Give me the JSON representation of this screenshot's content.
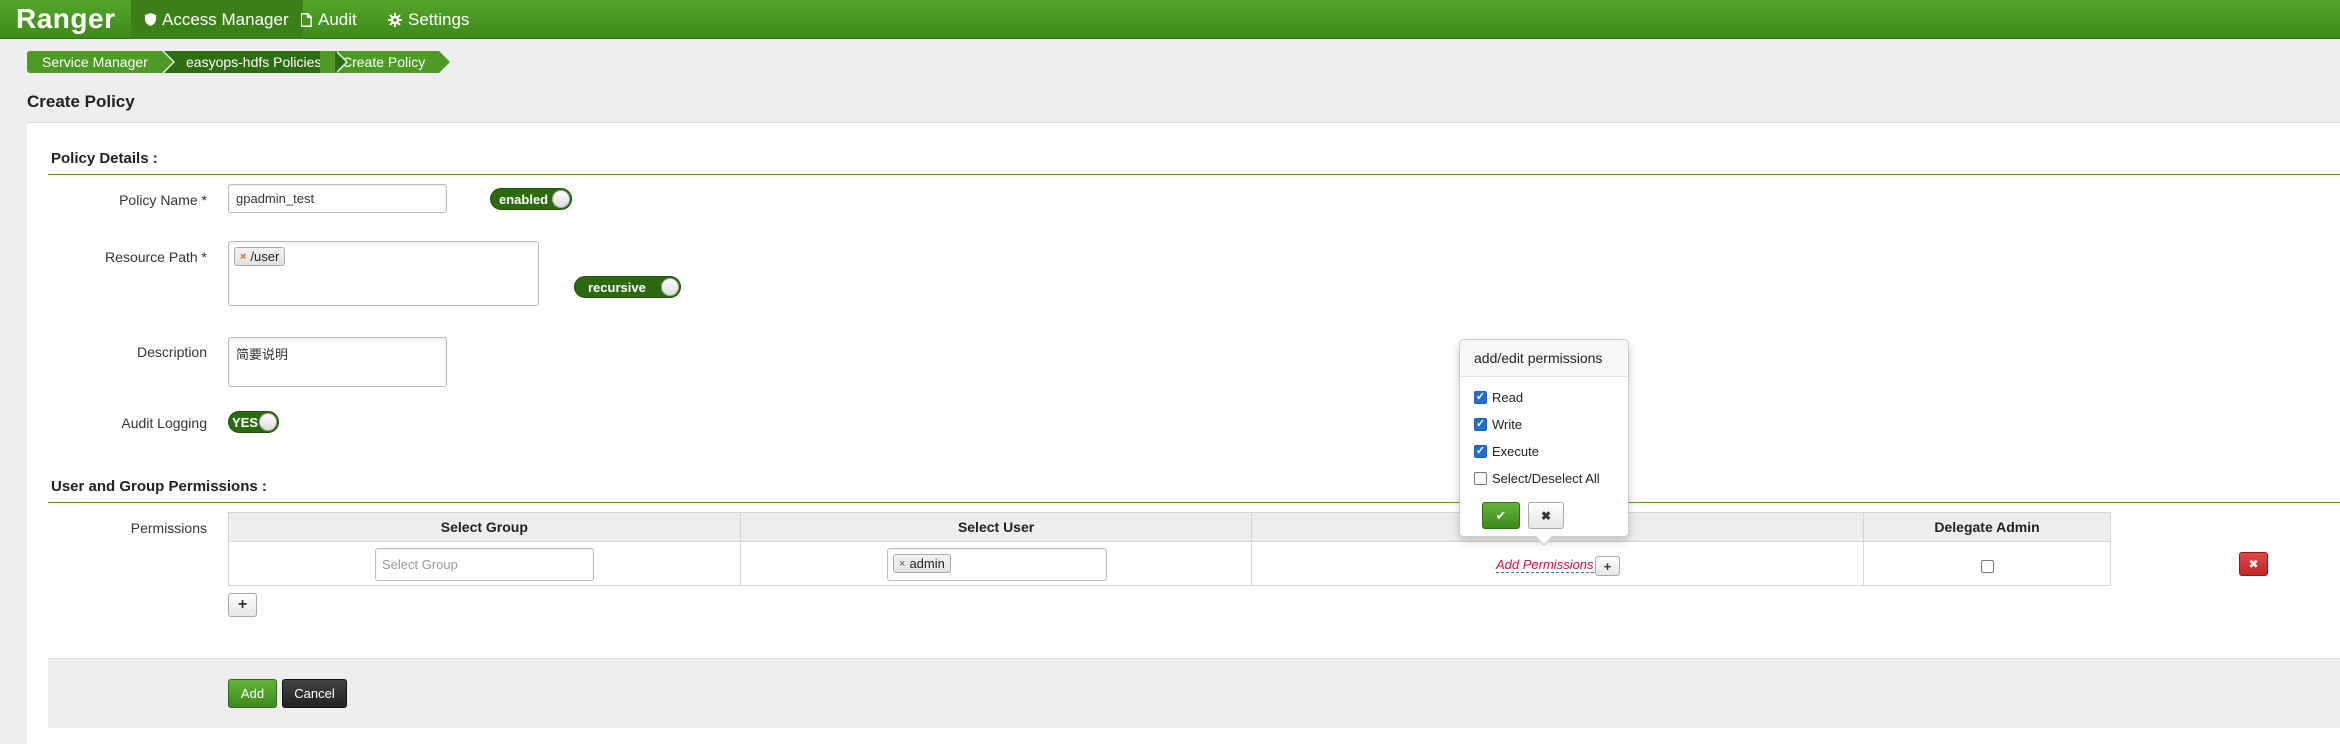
{
  "nav": {
    "brand": "Ranger",
    "items": [
      {
        "label": "Access Manager",
        "icon": "shield-icon",
        "active": true
      },
      {
        "label": "Audit",
        "icon": "file-icon",
        "active": false
      },
      {
        "label": "Settings",
        "icon": "gear-icon",
        "active": false
      }
    ]
  },
  "breadcrumb": [
    "Service Manager",
    "easyops-hdfs Policies",
    "Create Policy"
  ],
  "page_title": "Create Policy",
  "policy_details": {
    "heading": "Policy Details :",
    "policy_name_label": "Policy Name *",
    "policy_name_value": "gpadmin_test",
    "enabled_toggle": "enabled",
    "resource_path_label": "Resource Path *",
    "resource_path_tags": [
      "/user"
    ],
    "recursive_toggle": "recursive",
    "description_label": "Description",
    "description_value": "简要说明",
    "audit_logging_label": "Audit Logging",
    "audit_logging_toggle": "YES"
  },
  "permissions_section": {
    "heading": "User and Group Permissions :",
    "permissions_label": "Permissions",
    "columns": [
      "Select Group",
      "Select User",
      "",
      "Delegate Admin"
    ],
    "group_placeholder": "Select Group",
    "user_tags": [
      "admin"
    ],
    "add_permissions_link": "Add Permissions",
    "delegate_admin_checked": false
  },
  "popover": {
    "title": "add/edit permissions",
    "options": [
      {
        "label": "Read",
        "checked": true
      },
      {
        "label": "Write",
        "checked": true
      },
      {
        "label": "Execute",
        "checked": true
      },
      {
        "label": "Select/Deselect All",
        "checked": false
      }
    ]
  },
  "footer": {
    "add_label": "Add",
    "cancel_label": "Cancel"
  },
  "colors": {
    "brand_green": "#4d9a25",
    "dark_green": "#2f6d12",
    "danger_red": "#c12525",
    "link_red": "#d0103a"
  }
}
